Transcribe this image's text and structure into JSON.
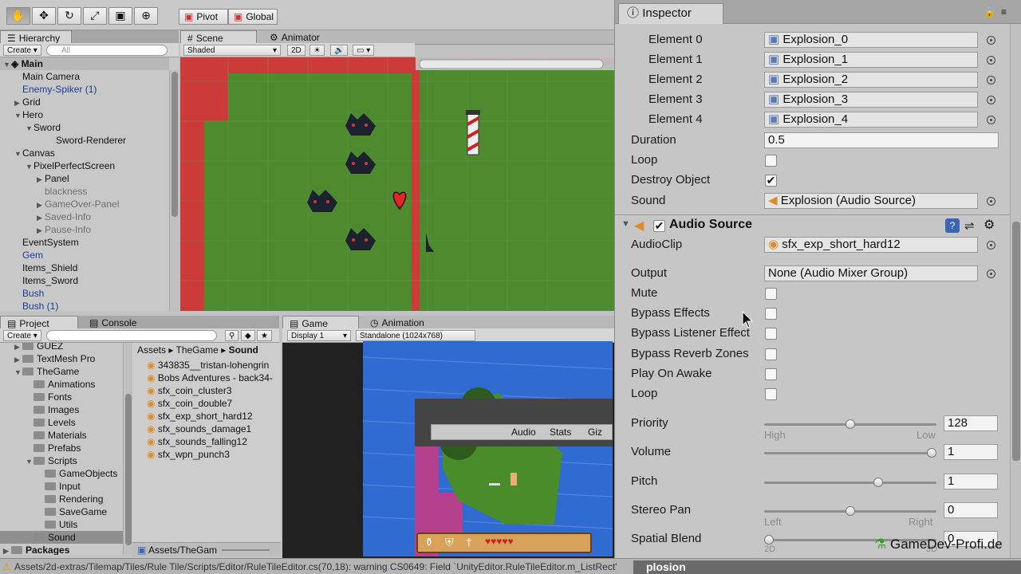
{
  "toolbar": {
    "tools": [
      "hand-icon",
      "move-icon",
      "rotate-icon",
      "scale-icon",
      "rect-icon",
      "transform-icon"
    ],
    "pivot_label": "Pivot",
    "global_label": "Global"
  },
  "hierarchy": {
    "tab_label": "Hierarchy",
    "create_label": "Create",
    "search_placeholder": "All",
    "scene_name": "Main",
    "items": [
      {
        "label": "Main Camera",
        "indent": 1,
        "style": "normal",
        "arrow": ""
      },
      {
        "label": "Enemy-Spiker (1)",
        "indent": 1,
        "style": "blue",
        "arrow": ""
      },
      {
        "label": "Grid",
        "indent": 1,
        "style": "normal",
        "arrow": "▶"
      },
      {
        "label": "Hero",
        "indent": 1,
        "style": "normal",
        "arrow": "▼"
      },
      {
        "label": "Sword",
        "indent": 2,
        "style": "normal",
        "arrow": "▼"
      },
      {
        "label": "Sword-Renderer",
        "indent": 4,
        "style": "normal",
        "arrow": ""
      },
      {
        "label": "Canvas",
        "indent": 1,
        "style": "normal",
        "arrow": "▼"
      },
      {
        "label": "PixelPerfectScreen",
        "indent": 2,
        "style": "normal",
        "arrow": "▼"
      },
      {
        "label": "Panel",
        "indent": 3,
        "style": "normal",
        "arrow": "▶"
      },
      {
        "label": "blackness",
        "indent": 3,
        "style": "dim",
        "arrow": ""
      },
      {
        "label": "GameOver-Panel",
        "indent": 3,
        "style": "dim",
        "arrow": "▶"
      },
      {
        "label": "Saved-Info",
        "indent": 3,
        "style": "dim",
        "arrow": "▶"
      },
      {
        "label": "Pause-Info",
        "indent": 3,
        "style": "dim",
        "arrow": "▶"
      },
      {
        "label": "EventSystem",
        "indent": 1,
        "style": "normal",
        "arrow": ""
      },
      {
        "label": "Gem",
        "indent": 1,
        "style": "blue",
        "arrow": ""
      },
      {
        "label": "Items_Shield",
        "indent": 1,
        "style": "normal",
        "arrow": ""
      },
      {
        "label": "Items_Sword",
        "indent": 1,
        "style": "normal",
        "arrow": ""
      },
      {
        "label": "Bush",
        "indent": 1,
        "style": "blue",
        "arrow": ""
      },
      {
        "label": "Bush (1)",
        "indent": 1,
        "style": "blue",
        "arrow": ""
      }
    ]
  },
  "scene": {
    "tab_label": "Scene",
    "animator_tab_label": "Animator",
    "shading_mode": "Shaded",
    "mode_2d": "2D"
  },
  "project": {
    "tab_label": "Project",
    "console_tab_label": "Console",
    "create_label": "Create",
    "folders": [
      {
        "label": "GUEZ",
        "indent": 1,
        "arrow": "▶",
        "selected": false
      },
      {
        "label": "TextMesh Pro",
        "indent": 1,
        "arrow": "▶",
        "selected": false
      },
      {
        "label": "TheGame",
        "indent": 1,
        "arrow": "▼",
        "selected": false
      },
      {
        "label": "Animations",
        "indent": 2,
        "arrow": "",
        "selected": false
      },
      {
        "label": "Fonts",
        "indent": 2,
        "arrow": "",
        "selected": false
      },
      {
        "label": "Images",
        "indent": 2,
        "arrow": "",
        "selected": false
      },
      {
        "label": "Levels",
        "indent": 2,
        "arrow": "",
        "selected": false
      },
      {
        "label": "Materials",
        "indent": 2,
        "arrow": "",
        "selected": false
      },
      {
        "label": "Prefabs",
        "indent": 2,
        "arrow": "",
        "selected": false
      },
      {
        "label": "Scripts",
        "indent": 2,
        "arrow": "▼",
        "selected": false
      },
      {
        "label": "GameObjects",
        "indent": 3,
        "arrow": "",
        "selected": false
      },
      {
        "label": "Input",
        "indent": 3,
        "arrow": "",
        "selected": false
      },
      {
        "label": "Rendering",
        "indent": 3,
        "arrow": "",
        "selected": false
      },
      {
        "label": "SaveGame",
        "indent": 3,
        "arrow": "",
        "selected": false
      },
      {
        "label": "Utils",
        "indent": 3,
        "arrow": "",
        "selected": false
      },
      {
        "label": "Sound",
        "indent": 2,
        "arrow": "",
        "selected": true
      },
      {
        "label": "Packages",
        "indent": 0,
        "arrow": "▶",
        "selected": false
      }
    ],
    "breadcrumb": [
      "Assets",
      "TheGame",
      "Sound"
    ],
    "files": [
      "343835__tristan-lohengrin",
      "Bobs Adventures - back34-",
      "sfx_coin_cluster3",
      "sfx_coin_double7",
      "sfx_exp_short_hard12",
      "sfx_sounds_damage1",
      "sfx_sounds_falling12",
      "sfx_wpn_punch3"
    ],
    "footer_path": "Assets/TheGam"
  },
  "game": {
    "tab_label": "Game",
    "animation_tab_label": "Animation",
    "display": "Display 1",
    "resolution": "Standalone (1024x768)",
    "overlay_buttons": [
      "Audio",
      "Stats",
      "Giz"
    ]
  },
  "inspector": {
    "tab_label": "Inspector",
    "elements": [
      {
        "label": "Element 0",
        "value": "Explosion_0"
      },
      {
        "label": "Element 1",
        "value": "Explosion_1"
      },
      {
        "label": "Element 2",
        "value": "Explosion_2"
      },
      {
        "label": "Element 3",
        "value": "Explosion_3"
      },
      {
        "label": "Element 4",
        "value": "Explosion_4"
      }
    ],
    "duration_label": "Duration",
    "duration_value": "0.5",
    "loop_label": "Loop",
    "destroy_label": "Destroy Object",
    "sound_label": "Sound",
    "sound_value": "Explosion (Audio Source)",
    "audio_source": {
      "title": "Audio Source",
      "clip_label": "AudioClip",
      "clip_value": "sfx_exp_short_hard12",
      "output_label": "Output",
      "output_value": "None (Audio Mixer Group)",
      "checkboxes": [
        {
          "label": "Mute",
          "checked": false
        },
        {
          "label": "Bypass Effects",
          "checked": false
        },
        {
          "label": "Bypass Listener Effect",
          "checked": false
        },
        {
          "label": "Bypass Reverb Zones",
          "checked": false
        },
        {
          "label": "Play On Awake",
          "checked": false
        },
        {
          "label": "Loop",
          "checked": false
        }
      ],
      "priority_label": "Priority",
      "priority_value": "128",
      "priority_high": "High",
      "priority_low": "Low",
      "volume_label": "Volume",
      "volume_value": "1",
      "pitch_label": "Pitch",
      "pitch_value": "1",
      "stereo_label": "Stereo Pan",
      "stereo_value": "0",
      "stereo_left": "Left",
      "stereo_right": "Right",
      "spatial_label": "Spatial Blend",
      "spatial_value": "0",
      "spatial_2d": "2D",
      "spatial_3d": "3D"
    }
  },
  "watermark": "GameDev-Profi.de",
  "statusbar": {
    "message": "Assets/2d-extras/Tilemap/Tiles/Rule Tile/Scripts/Editor/RuleTileEditor.cs(70,18): warning CS0649: Field `UnityEditor.RuleTileEditor.m_ListRect'",
    "overlay": "plosion"
  }
}
